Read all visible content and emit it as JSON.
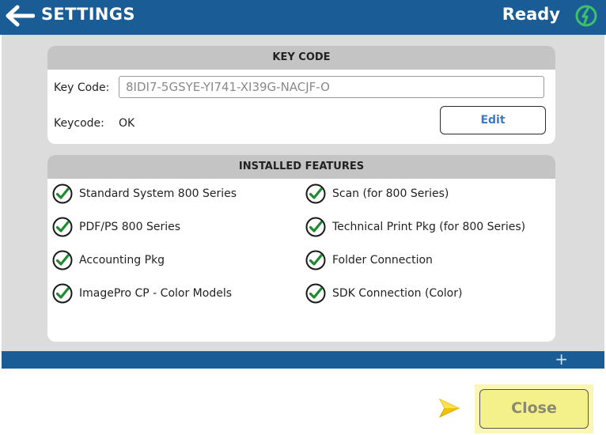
{
  "header": {
    "back_icon": "back-arrow-icon",
    "title": "SETTINGS",
    "status": "Ready",
    "status_icon": "power-status-icon"
  },
  "key_code": {
    "heading": "KEY CODE",
    "key_label": "Key Code:",
    "key_value": "8IDI7-5GSYE-YI741-XI39G-NACJF-O",
    "status_label": "Keycode:",
    "status_value": "OK",
    "edit_label": "Edit"
  },
  "features": {
    "heading": "INSTALLED FEATURES",
    "items": [
      "Standard System 800 Series",
      "Scan (for 800 Series)",
      "PDF/PS 800 Series",
      "Technical Print Pkg (for 800 Series)",
      "Accounting Pkg",
      "Folder Connection",
      "ImagePro CP - Color Models",
      "SDK Connection (Color)"
    ]
  },
  "footer": {
    "plus_icon": "+",
    "close_label": "Close"
  },
  "colors": {
    "header_bg": "#1a5c95",
    "panel_bg": "#dcdcdc",
    "check_green": "#1f8a2e",
    "edit_text": "#3a7cc4",
    "close_bg": "#f4f08a",
    "pointer": "#f2c400"
  }
}
